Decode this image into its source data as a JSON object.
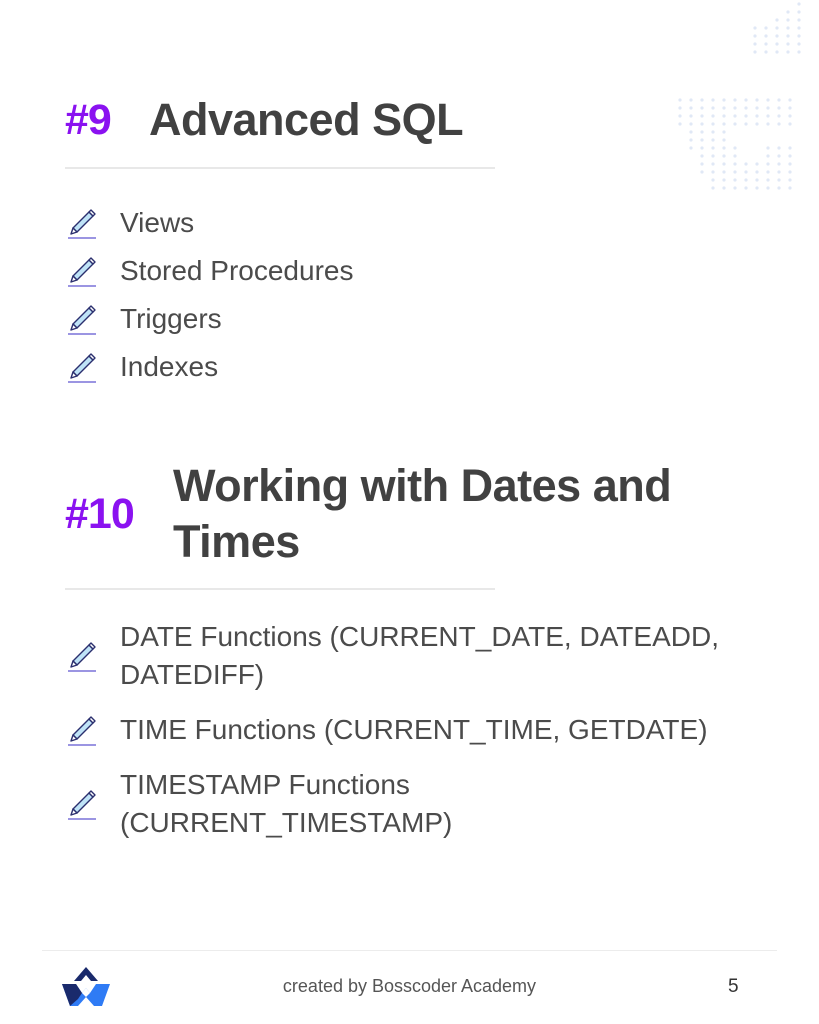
{
  "sections": [
    {
      "number": "#9",
      "title": "Advanced SQL",
      "items": [
        {
          "icon": "pencil-icon",
          "label": "Views"
        },
        {
          "icon": "pencil-icon",
          "label": "Stored Procedures"
        },
        {
          "icon": "pencil-icon",
          "label": "Triggers"
        },
        {
          "icon": "pencil-icon",
          "label": "Indexes"
        }
      ]
    },
    {
      "number": "#10",
      "title": "Working with Dates and Times",
      "items": [
        {
          "icon": "pencil-icon",
          "label": "DATE Functions (CURRENT_DATE, DATEADD, DATEDIFF)"
        },
        {
          "icon": "pencil-icon",
          "label": "TIME Functions (CURRENT_TIME, GETDATE)"
        },
        {
          "icon": "pencil-icon",
          "label": "TIMESTAMP Functions (CURRENT_TIMESTAMP)"
        }
      ]
    }
  ],
  "footer": {
    "logo": "bosscoder-logo-icon",
    "credit": "created by Bosscoder Academy",
    "page_number": "5"
  },
  "colors": {
    "accent": "#8a12f0",
    "heading": "#414141",
    "body_text": "#4b4b4b",
    "logo_dark": "#1a2a6c",
    "logo_light": "#2f7bf5"
  }
}
